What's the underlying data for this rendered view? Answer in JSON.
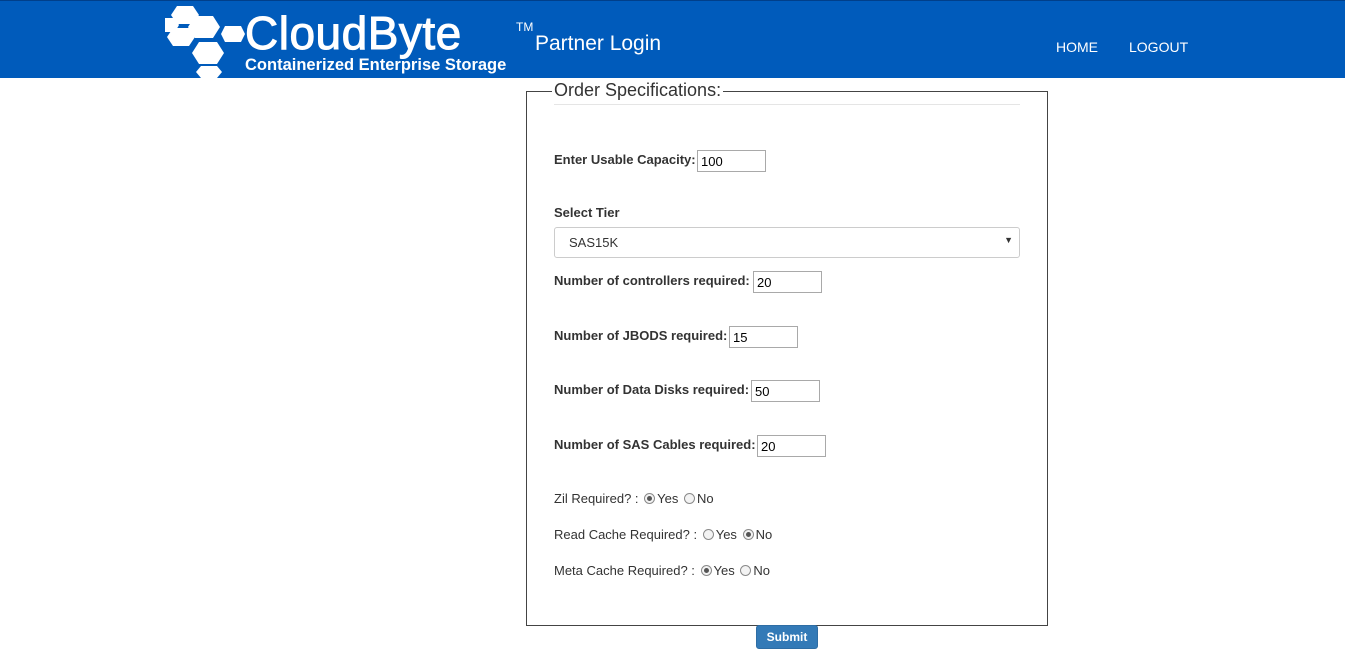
{
  "header": {
    "brand_name": "CloudByte",
    "brand_tm": "TM",
    "brand_tagline": "Containerized Enterprise Storage",
    "page_title": "Partner Login",
    "nav": {
      "home": "HOME",
      "logout": "LOGOUT"
    },
    "bg_color": "#005bbb"
  },
  "form": {
    "legend": "Order Specifications:",
    "usable_capacity": {
      "label": "Enter Usable Capacity:",
      "value": "100"
    },
    "tier": {
      "label": "Select Tier",
      "selected": "SAS15K"
    },
    "controllers": {
      "label": "Number of controllers required:",
      "value": "20"
    },
    "jbods": {
      "label": "Number of JBODS required:",
      "value": "15"
    },
    "data_disks": {
      "label": "Number of Data Disks required:",
      "value": "50"
    },
    "sas_cables": {
      "label": "Number of SAS Cables required:",
      "value": "20"
    },
    "zil": {
      "label": "Zil Required? :",
      "yes": "Yes",
      "no": "No",
      "selected": "Yes"
    },
    "read_cache": {
      "label": "Read Cache Required? :",
      "yes": "Yes",
      "no": "No",
      "selected": "No"
    },
    "meta_cache": {
      "label": "Meta Cache Required? :",
      "yes": "Yes",
      "no": "No",
      "selected": "Yes"
    },
    "submit_label": "Submit"
  }
}
